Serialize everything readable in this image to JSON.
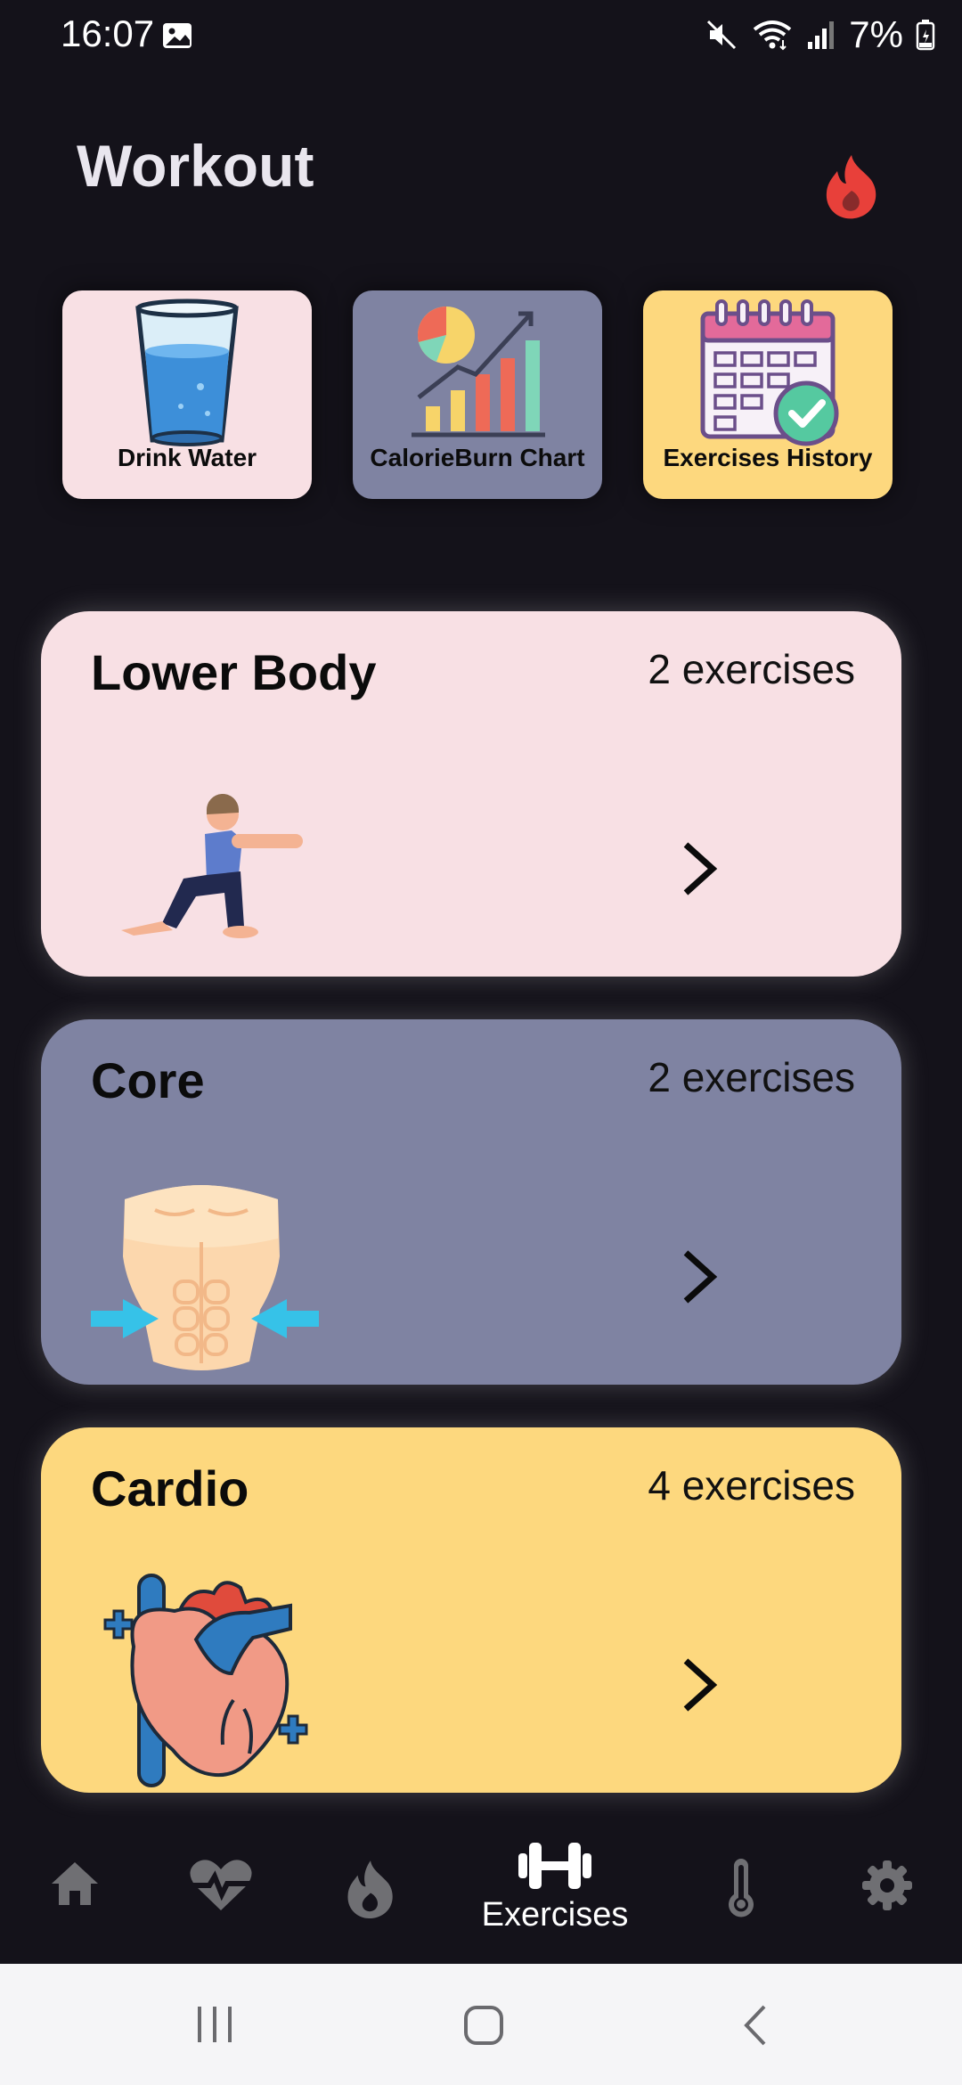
{
  "status_bar": {
    "time": "16:07",
    "battery": "7%",
    "icons": [
      "gallery-icon",
      "mute-icon",
      "wifi-icon",
      "signal-icon",
      "battery-icon"
    ]
  },
  "header": {
    "title": "Workout",
    "icon": "flame-icon",
    "accent_color": "#e8403a"
  },
  "tiles": [
    {
      "label": "Drink Water",
      "color": "#f8e0e4",
      "icon": "water-glass-icon"
    },
    {
      "label": "CalorieBurn Chart",
      "color": "#7f83a2",
      "icon": "bar-chart-icon"
    },
    {
      "label": "Exercises History",
      "color": "#fdd87e",
      "icon": "calendar-check-icon"
    }
  ],
  "categories": [
    {
      "title": "Lower Body",
      "count": "2 exercises",
      "color": "#f8e0e4",
      "icon": "lunge-person-icon"
    },
    {
      "title": "Core",
      "count": "2 exercises",
      "color": "#7f83a2",
      "icon": "abs-torso-icon"
    },
    {
      "title": "Cardio",
      "count": "4 exercises",
      "color": "#fdd87e",
      "icon": "heart-icon"
    }
  ],
  "bottom_nav": {
    "items": [
      {
        "icon": "home-icon",
        "label": ""
      },
      {
        "icon": "heart-pulse-icon",
        "label": ""
      },
      {
        "icon": "flame-icon",
        "label": ""
      },
      {
        "icon": "dumbbell-icon",
        "label": "Exercises",
        "active": true
      },
      {
        "icon": "thermometer-icon",
        "label": ""
      },
      {
        "icon": "gear-icon",
        "label": ""
      }
    ],
    "inactive_color": "#6f6f73",
    "active_color": "#ffffff"
  },
  "system_nav": {
    "icons": [
      "recent-apps-icon",
      "home-button-icon",
      "back-icon"
    ]
  }
}
